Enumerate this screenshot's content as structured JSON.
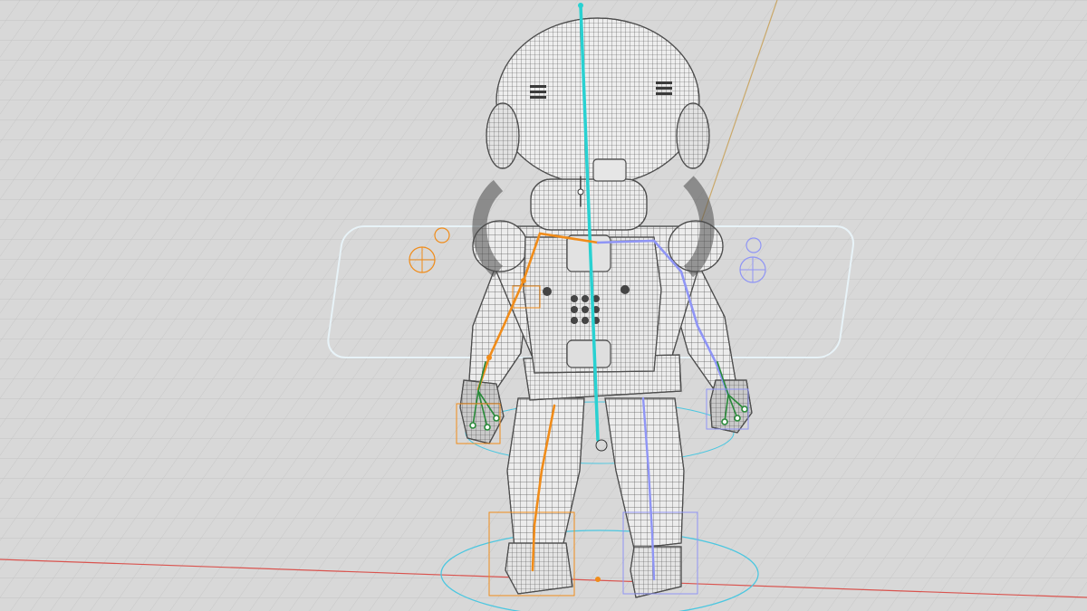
{
  "viewport": {
    "kind": "3D viewport",
    "mode": "wireframe",
    "background_color": "#d8d8d8",
    "grid_color": "#bdbdbd",
    "x_axis_color": "#d9544f",
    "y_axis_color": "#c9a86a"
  },
  "model": {
    "subject": "astronaut",
    "view": "back",
    "wire_color": "#5a5a5a",
    "fill_color": "#ececec"
  },
  "rig": {
    "spine_color": "#29d1d1",
    "left_chain_color": "#f08c1a",
    "right_chain_color": "#8f95f5",
    "finger_color": "#2a8a3a",
    "root_circle_color": "#4cc7e0",
    "control_panel_color": "#e8f3f8"
  }
}
